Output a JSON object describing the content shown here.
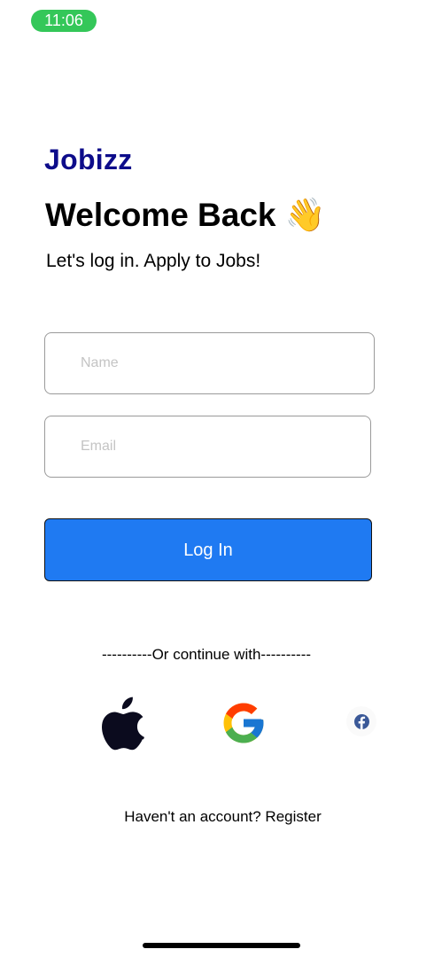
{
  "status_bar": {
    "time": "11:06"
  },
  "brand": {
    "name": "Jobizz"
  },
  "header": {
    "title": "Welcome Back 👋",
    "subtitle": "Let's log in. Apply to Jobs!"
  },
  "form": {
    "name_placeholder": "Name",
    "name_value": "",
    "email_placeholder": "Email",
    "email_value": "",
    "login_label": "Log In"
  },
  "social": {
    "divider_text": "----------Or continue with----------",
    "providers": [
      "apple-icon",
      "google-icon",
      "facebook-icon"
    ]
  },
  "footer": {
    "register_text": "Haven't an account? Register"
  },
  "colors": {
    "brand": "#0d0c8a",
    "primary_button": "#1f7af2",
    "status_pill": "#34c759"
  }
}
